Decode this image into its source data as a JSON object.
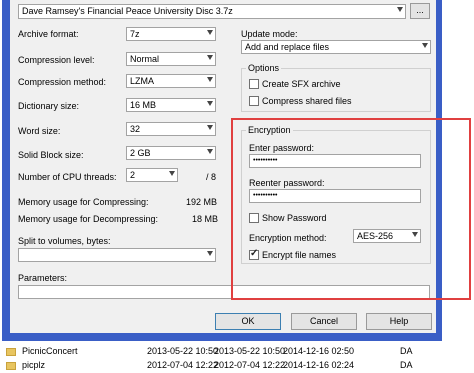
{
  "archive_path": "Dave Ramsey's Financial Peace University Disc 3.7z",
  "browse_label": "...",
  "left": {
    "archive_format": {
      "label": "Archive format:",
      "value": "7z"
    },
    "compression_level": {
      "label": "Compression level:",
      "value": "Normal"
    },
    "compression_method": {
      "label": "Compression method:",
      "value": "LZMA"
    },
    "dictionary_size": {
      "label": "Dictionary size:",
      "value": "16 MB"
    },
    "word_size": {
      "label": "Word size:",
      "value": "32"
    },
    "solid_block_size": {
      "label": "Solid Block size:",
      "value": "2 GB"
    },
    "cpu_threads": {
      "label": "Number of CPU threads:",
      "value": "2",
      "max": "/ 8"
    },
    "memory_compress": {
      "label": "Memory usage for Compressing:",
      "value": "192 MB"
    },
    "memory_decompress": {
      "label": "Memory usage for Decompressing:",
      "value": "18 MB"
    },
    "split": {
      "label": "Split to volumes, bytes:",
      "value": ""
    },
    "parameters": {
      "label": "Parameters:",
      "value": ""
    }
  },
  "right": {
    "update_mode": {
      "label": "Update mode:",
      "value": "Add and replace files"
    },
    "options": {
      "title": "Options",
      "create_sfx": {
        "label": "Create SFX archive",
        "checked": false
      },
      "compress_shared": {
        "label": "Compress shared files",
        "checked": false
      }
    },
    "encryption": {
      "title": "Encryption",
      "enter_password_label": "Enter password:",
      "enter_password_value": "••••••••••",
      "reenter_password_label": "Reenter password:",
      "reenter_password_value": "••••••••••",
      "show_password": {
        "label": "Show Password",
        "checked": false
      },
      "method_label": "Encryption method:",
      "method_value": "AES-256",
      "encrypt_names": {
        "label": "Encrypt file names",
        "checked": true
      }
    }
  },
  "buttons": {
    "ok": "OK",
    "cancel": "Cancel",
    "help": "Help"
  },
  "file_list": [
    {
      "name": "PicnicConcert",
      "date1": "2013-05-22 10:50",
      "date2": "2013-05-22 10:50",
      "date3": "2014-12-16 02:50",
      "attr": "DA"
    },
    {
      "name": "picplz",
      "date1": "2012-07-04 12:22",
      "date2": "2012-07-04 12:22",
      "date3": "2014-12-16 02:24",
      "attr": "DA"
    }
  ],
  "colors": {
    "window_border": "#3a5ec6",
    "highlight": "#e04040",
    "dialog_bg": "#f0f0f0"
  }
}
